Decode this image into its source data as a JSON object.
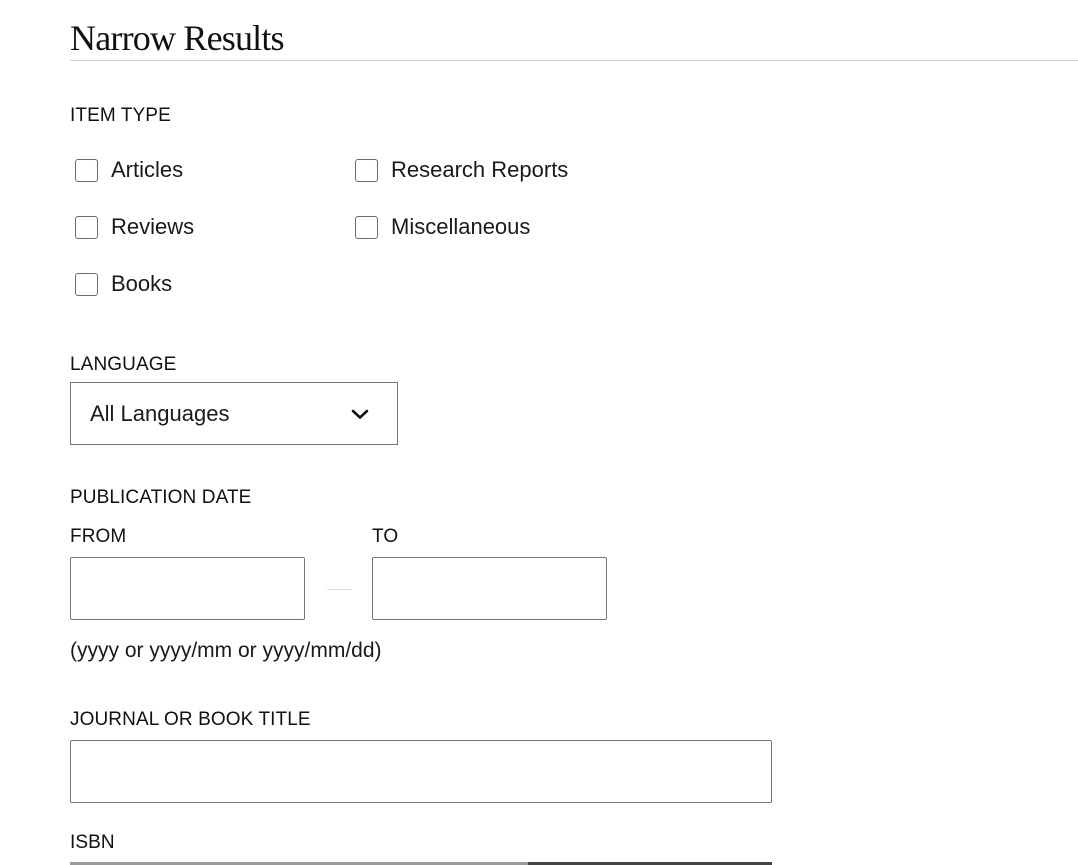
{
  "panel": {
    "title": "Narrow Results"
  },
  "item_type": {
    "label": "ITEM TYPE",
    "options": [
      {
        "label": "Articles",
        "checked": false
      },
      {
        "label": "Research Reports",
        "checked": false
      },
      {
        "label": "Reviews",
        "checked": false
      },
      {
        "label": "Miscellaneous",
        "checked": false
      },
      {
        "label": "Books",
        "checked": false
      }
    ]
  },
  "language": {
    "label": "LANGUAGE",
    "selected": "All Languages",
    "icon": "chevron-down-icon"
  },
  "publication_date": {
    "label": "PUBLICATION DATE",
    "from_label": "FROM",
    "from_value": "",
    "to_label": "TO",
    "to_value": "",
    "hint": "(yyyy or yyyy/mm or yyyy/mm/dd)"
  },
  "journal_title": {
    "label": "JOURNAL OR BOOK TITLE",
    "value": ""
  },
  "isbn": {
    "label": "ISBN"
  }
}
